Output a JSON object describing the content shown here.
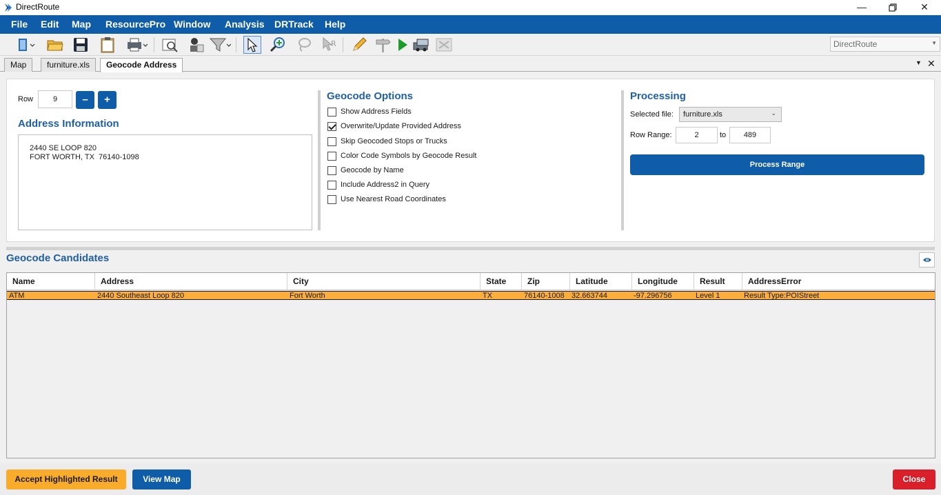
{
  "window": {
    "title": "DirectRoute"
  },
  "menu": [
    "File",
    "Edit",
    "Map",
    "ResourcePro",
    "Window",
    "Analysis",
    "DRTrack",
    "Help"
  ],
  "toolbar": {
    "icons": [
      "book-icon",
      "folder-open-icon",
      "save-icon",
      "clipboard-icon",
      "printer-icon",
      "preview-icon",
      "truck-driver-icon",
      "filter-icon",
      "select-arrow-icon",
      "zoom-in-icon",
      "lasso-icon",
      "reset-select-icon",
      "pencil-icon",
      "signpost-icon",
      "play-icon",
      "route-tools-icon",
      "disabled-grid-icon"
    ],
    "profile": "DirectRoute"
  },
  "tabs": [
    {
      "label": "Map",
      "active": false
    },
    {
      "label": "furniture.xls",
      "active": false
    },
    {
      "label": "Geocode Address",
      "active": true
    }
  ],
  "row": {
    "label": "Row",
    "value": "9",
    "minus": "–",
    "plus": "+"
  },
  "address_info": {
    "heading": "Address Information",
    "text": "2440 SE LOOP 820\nFORT WORTH, TX  76140-1098"
  },
  "geocode_options": {
    "heading": "Geocode Options",
    "items": [
      {
        "label": "Show Address Fields",
        "checked": false
      },
      {
        "label": "Overwrite/Update Provided Address",
        "checked": true
      },
      {
        "label": "Skip Geocoded Stops or Trucks",
        "checked": false
      },
      {
        "label": "Color Code Symbols by Geocode Result",
        "checked": false
      },
      {
        "label": "Geocode by Name",
        "checked": false
      },
      {
        "label": "Include Address2 in Query",
        "checked": false
      },
      {
        "label": "Use Nearest Road Coordinates",
        "checked": false
      }
    ]
  },
  "processing": {
    "heading": "Processing",
    "selected_file_label": "Selected file:",
    "selected_file": "furniture.xls",
    "row_range_label": "Row Range:",
    "range_from": "2",
    "range_to_label": "to",
    "range_to": "489",
    "process_button": "Process Range"
  },
  "candidates": {
    "heading": "Geocode Candidates",
    "columns": [
      "Name",
      "Address",
      "City",
      "State",
      "Zip",
      "Latitude",
      "Longitude",
      "Result",
      "AddressError"
    ],
    "rows": [
      [
        "ATM",
        "2440 Southeast Loop 820",
        "Fort Worth",
        "TX",
        "76140-1008",
        "32.663744",
        "-97.296756",
        "Level 1",
        "Result Type:POIStreet"
      ]
    ]
  },
  "footer": {
    "accept": "Accept Highlighted Result",
    "view_map": "View Map",
    "close": "Close"
  },
  "colors": {
    "menu_blue": "#0f5ca8",
    "heading_blue": "#1f5fa5",
    "highlight_row": "#fbae3c",
    "accept_button": "#f9ab2c",
    "close_button": "#d9202a"
  }
}
